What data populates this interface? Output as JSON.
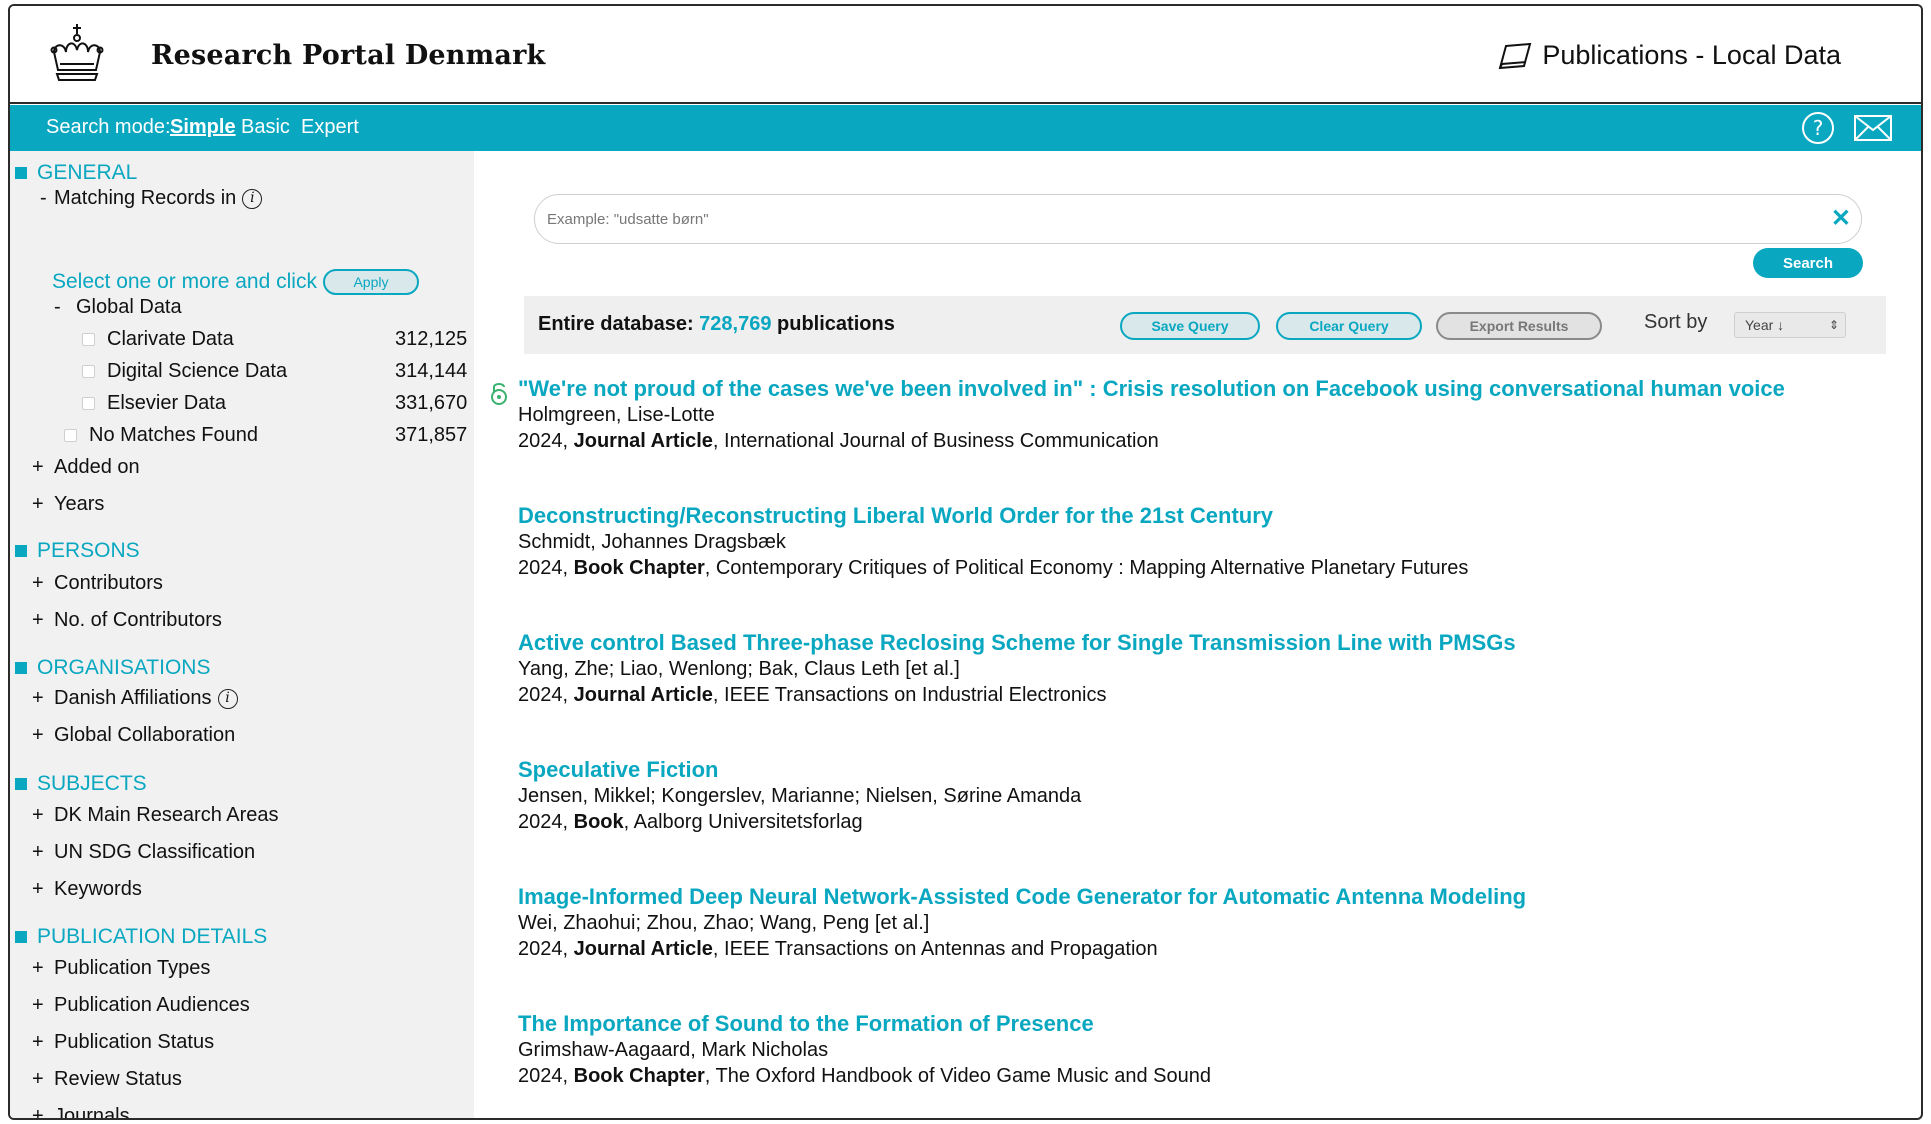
{
  "header": {
    "brand": "Research Portal Denmark",
    "section": "Publications - Local Data"
  },
  "modebar": {
    "label": "Search mode:",
    "modes": [
      "Simple",
      "Basic",
      "Expert"
    ],
    "active_mode": "Simple"
  },
  "sidebar": {
    "general": "GENERAL",
    "matching_records": "Matching Records in",
    "select_hint": "Select one or more and click",
    "apply": "Apply",
    "global_data": "Global Data",
    "sources": [
      {
        "label": "Clarivate Data",
        "count": "312,125"
      },
      {
        "label": "Digital Science Data",
        "count": "314,144"
      },
      {
        "label": "Elsevier Data",
        "count": "331,670"
      }
    ],
    "no_matches": {
      "label": "No Matches Found",
      "count": "371,857"
    },
    "added_on": "Added on",
    "years": "Years",
    "persons": "PERSONS",
    "contributors": "Contributors",
    "no_contributors": "No. of Contributors",
    "organisations": "ORGANISATIONS",
    "danish_affiliations": "Danish Affiliations",
    "global_collaboration": "Global Collaboration",
    "subjects": "SUBJECTS",
    "dk_main": "DK Main Research Areas",
    "un_sdg": "UN SDG Classification",
    "keywords": "Keywords",
    "pub_details": "PUBLICATION DETAILS",
    "pub_types": "Publication Types",
    "pub_audiences": "Publication Audiences",
    "pub_status": "Publication Status",
    "review_status": "Review Status",
    "journals": "Journals"
  },
  "search": {
    "placeholder": "Example: \"udsatte børn\"",
    "button": "Search"
  },
  "infobar": {
    "prefix": "Entire database:",
    "count": "728,769",
    "suffix": "publications",
    "save": "Save Query",
    "clear": "Clear Query",
    "export": "Export Results",
    "sort_label": "Sort by",
    "sort_value": "Year ↓"
  },
  "results": [
    {
      "title": "\"We're not proud of the cases we've been involved in\" : Crisis resolution on Facebook using conversational human voice",
      "authors": "Holmgreen, Lise-Lotte",
      "year": "2024,",
      "type": "Journal Article",
      "venue": ", International Journal of Business Communication"
    },
    {
      "title": "Deconstructing/Reconstructing Liberal World Order for the 21st Century",
      "authors": "Schmidt, Johannes Dragsbæk",
      "year": "2024,",
      "type": "Book Chapter",
      "venue": ", Contemporary Critiques of Political Economy : Mapping Alternative Planetary Futures"
    },
    {
      "title": "Active control Based Three-phase Reclosing Scheme for Single Transmission Line with PMSGs",
      "authors": "Yang, Zhe; Liao, Wenlong; Bak, Claus Leth [et al.]",
      "year": "2024,",
      "type": "Journal Article",
      "venue": ", IEEE Transactions on Industrial Electronics"
    },
    {
      "title": "Speculative Fiction",
      "authors": "Jensen, Mikkel; Kongerslev, Marianne; Nielsen, Sørine Amanda",
      "year": "2024,",
      "type": "Book",
      "venue": ", Aalborg Universitetsforlag"
    },
    {
      "title": "Image-Informed Deep Neural Network-Assisted Code Generator for Automatic Antenna Modeling",
      "authors": "Wei, Zhaohui; Zhou, Zhao; Wang, Peng [et al.]",
      "year": "2024,",
      "type": "Journal Article",
      "venue": ", IEEE Transactions on Antennas and Propagation"
    },
    {
      "title": "The Importance of Sound to the Formation of Presence",
      "authors": "Grimshaw-Aagaard, Mark Nicholas",
      "year": "2024,",
      "type": "Book Chapter",
      "venue": ", The Oxford Handbook of Video Game Music and Sound"
    }
  ],
  "colors": {
    "accent": "#0aa7c1",
    "sidebar_bg": "#f1f1f1"
  }
}
